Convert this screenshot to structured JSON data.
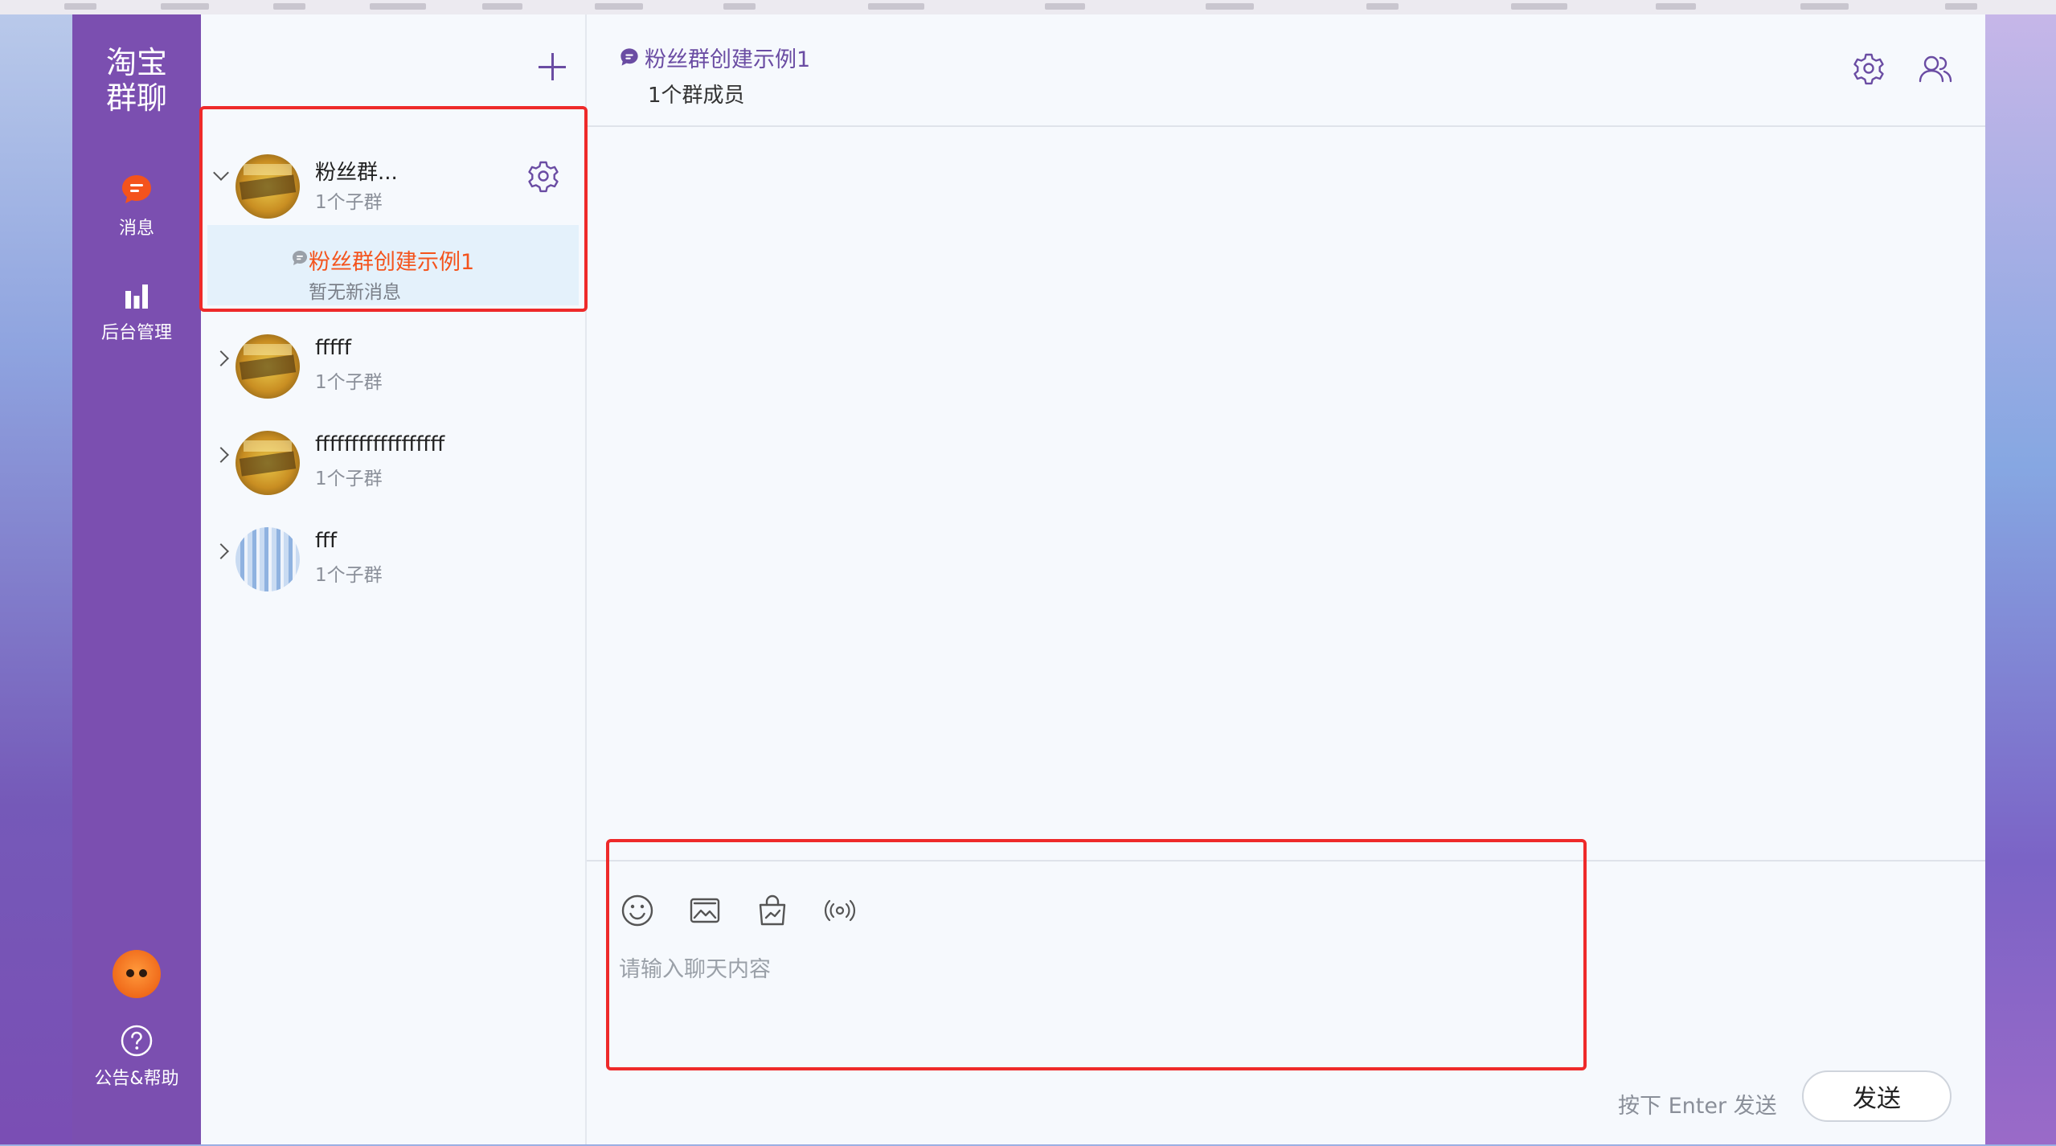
{
  "brand": {
    "line1": "淘宝",
    "line2": "群聊"
  },
  "nav": {
    "messages_label": "消息",
    "admin_label": "后台管理",
    "help_label": "公告&帮助"
  },
  "groups": [
    {
      "name": "粉丝群...",
      "sub": "1个子群",
      "expanded": true,
      "avatar": "gold",
      "subgroup": {
        "name": "粉丝群创建示例1",
        "status": "暂无新消息"
      }
    },
    {
      "name": "fffff",
      "sub": "1个子群",
      "expanded": false,
      "avatar": "gold"
    },
    {
      "name": "ffffffffffffffffff",
      "sub": "1个子群",
      "expanded": false,
      "avatar": "gold"
    },
    {
      "name": "fff",
      "sub": "1个子群",
      "expanded": false,
      "avatar": "blue"
    }
  ],
  "chat": {
    "title": "粉丝群创建示例1",
    "members": "1个群成员",
    "input_placeholder": "请输入聊天内容",
    "send_hint": "按下 Enter 发送",
    "send_label": "发送"
  },
  "colors": {
    "nav_bg": "#7b4fb0",
    "accent": "#6a4ca3",
    "active_text": "#f4531c",
    "highlight_border": "#ee2a2a",
    "selected_bg": "#e4f1fb"
  },
  "icons": [
    "chat-bubble-icon",
    "bar-chart-icon",
    "help-icon",
    "plus-icon",
    "chevron-down-icon",
    "chevron-right-icon",
    "gear-icon",
    "members-icon",
    "emoji-icon",
    "image-icon",
    "shopping-bag-icon",
    "broadcast-icon"
  ]
}
